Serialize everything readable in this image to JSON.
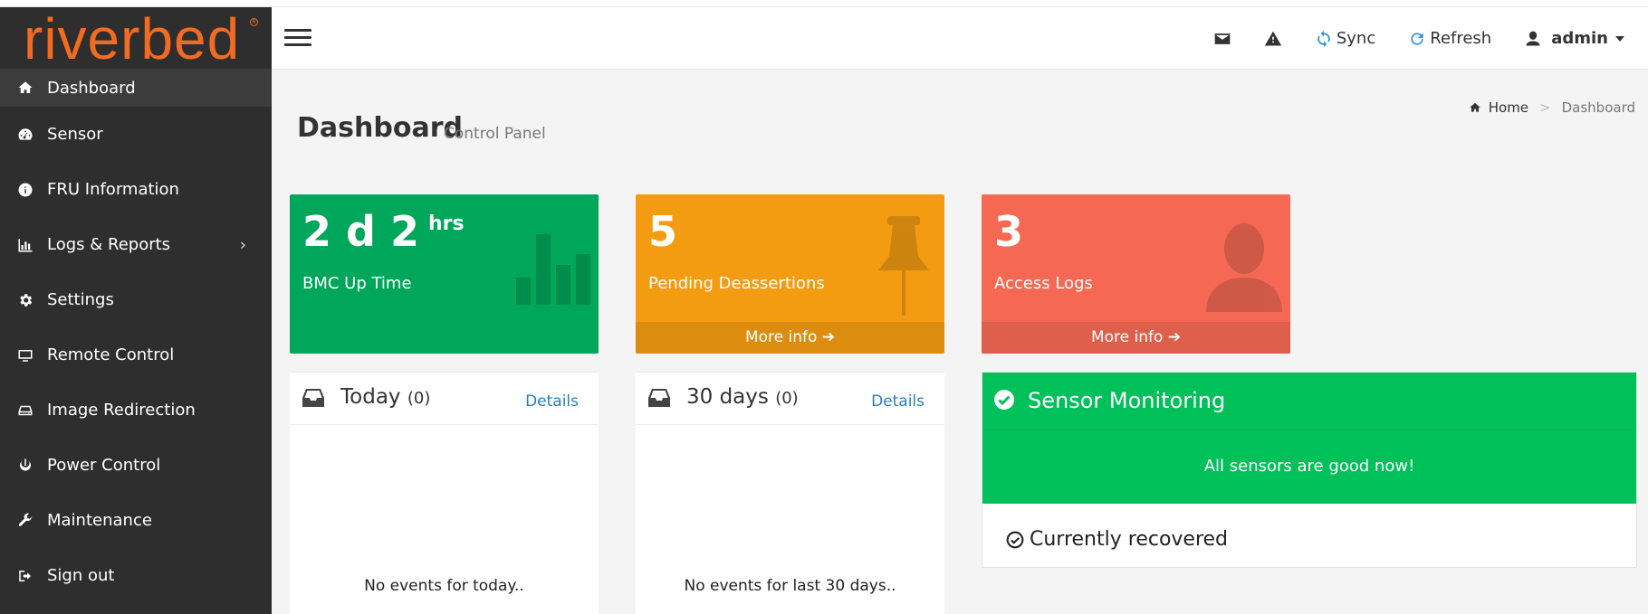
{
  "brand": {
    "logo_text": "riverbed"
  },
  "header": {
    "sync_label": "Sync",
    "refresh_label": "Refresh",
    "user_label": "admin"
  },
  "sidebar": {
    "items": [
      {
        "label": "Dashboard",
        "icon": "home-icon",
        "active": true
      },
      {
        "label": "Sensor",
        "icon": "dashboard-gauge-icon"
      },
      {
        "label": "FRU Information",
        "icon": "info-circle-icon"
      },
      {
        "label": "Logs & Reports",
        "icon": "bar-chart-icon",
        "has_children": true
      },
      {
        "label": "Settings",
        "icon": "gear-icon"
      },
      {
        "label": "Remote Control",
        "icon": "monitor-icon"
      },
      {
        "label": "Image Redirection",
        "icon": "drive-icon"
      },
      {
        "label": "Power Control",
        "icon": "power-icon"
      },
      {
        "label": "Maintenance",
        "icon": "wrench-icon"
      },
      {
        "label": "Sign out",
        "icon": "sign-out-icon"
      }
    ]
  },
  "page": {
    "title": "Dashboard",
    "subtitle": "Control Panel",
    "breadcrumb": {
      "home": "Home",
      "separator": ">",
      "current": "Dashboard"
    }
  },
  "info_boxes": {
    "uptime": {
      "value": "2 d 2",
      "unit": "hrs",
      "caption": "BMC Up Time",
      "color": "#00a65a"
    },
    "pending": {
      "value": "5",
      "caption": "Pending Deassertions",
      "more": "More info",
      "color": "#f39c12"
    },
    "access": {
      "value": "3",
      "caption": "Access Logs",
      "more": "More info",
      "color": "#f56954"
    }
  },
  "panels": {
    "today": {
      "title": "Today",
      "count": "(0)",
      "details": "Details",
      "empty": "No events for today.."
    },
    "thirty": {
      "title": "30 days",
      "count": "(0)",
      "details": "Details",
      "empty": "No events for last 30 days.."
    }
  },
  "sensor_monitoring": {
    "title": "Sensor Monitoring",
    "message": "All sensors are good now!",
    "status": "Currently recovered",
    "color": "#00c05a"
  }
}
